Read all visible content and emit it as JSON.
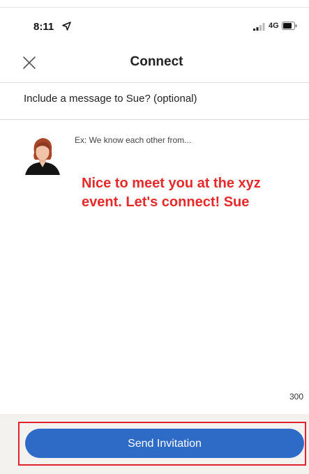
{
  "status_bar": {
    "time": "8:11",
    "network": "4G",
    "icons": [
      "location-icon",
      "signal-icon",
      "battery-icon"
    ]
  },
  "header": {
    "title": "Connect",
    "close_icon": "close-icon"
  },
  "prompt": "Include a message to Sue? (optional)",
  "message": {
    "placeholder": "Ex: We know each other from...",
    "text": "Nice to meet you at the xyz\nevent. Let's connect! Sue",
    "char_remaining": "300"
  },
  "footer": {
    "send_label": "Send Invitation"
  },
  "colors": {
    "accent": "#2e6bc6",
    "annotation_red": "#e8292a",
    "highlight_border": "#e0242d",
    "footer_bg": "#f3f2ef"
  }
}
